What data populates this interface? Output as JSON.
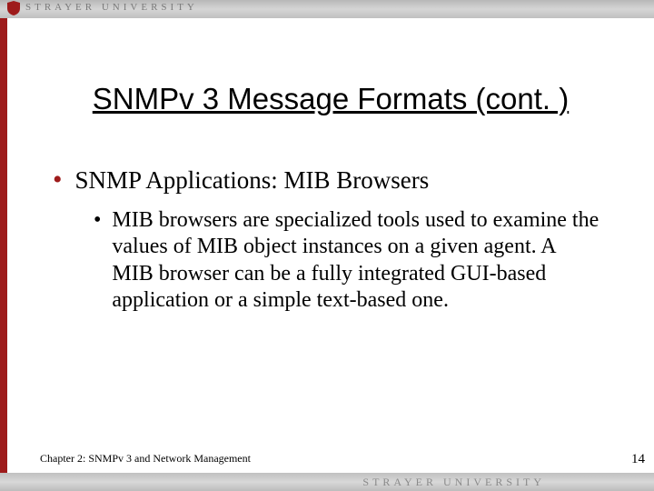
{
  "brand_top": "STRAYER UNIVERSITY",
  "brand_bottom": "STRAYER UNIVERSITY",
  "title": "SNMPv 3 Message Formats (cont. )",
  "bullet1": "SNMP Applications: MIB Browsers",
  "bullet2": "MIB browsers are specialized tools used to examine the values of MIB object instances on a given agent. A MIB browser can be a fully integrated GUI-based application or a simple text-based one.",
  "footer_left": "Chapter 2: SNMPv 3 and Network Management",
  "page_number": "14"
}
